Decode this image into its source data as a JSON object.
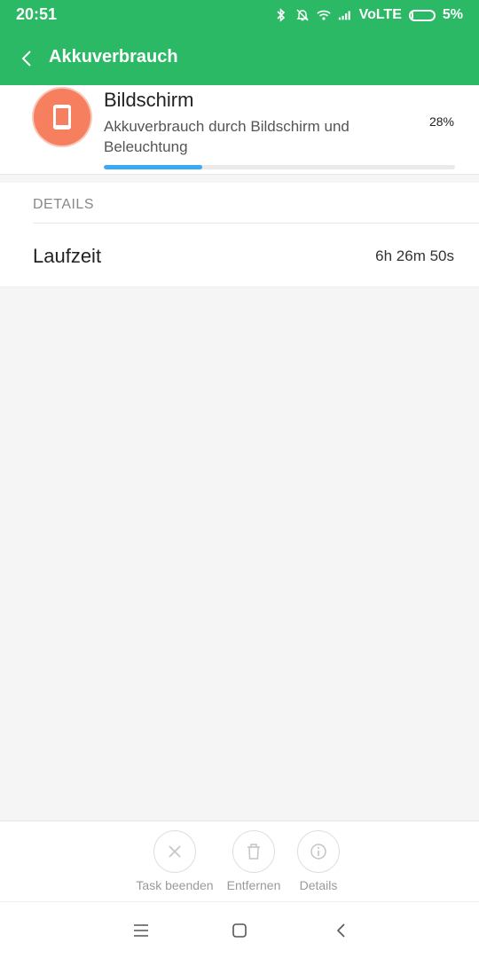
{
  "status": {
    "time": "20:51",
    "network": "VoLTE",
    "battery": "5%",
    "icons": [
      "bluetooth-icon",
      "notifications-off-icon",
      "wifi-icon",
      "signal-icon",
      "battery-icon"
    ]
  },
  "toolbar": {
    "title": "Akkuverbrauch",
    "back_icon": "chevron-left-icon"
  },
  "app": {
    "name": "Bildschirm",
    "description": "Akkuverbrauch durch Bildschirm und Beleuchtung",
    "percent": "28%",
    "usage_fraction": 0.28,
    "icon": "tablet-icon",
    "icon_color": "#f57f5f"
  },
  "details": {
    "header": "DETAILS",
    "runtime_label": "Laufzeit",
    "runtime_value": "6h 26m 50s"
  },
  "actions": {
    "end_task": "Task beenden",
    "remove": "Entfernen",
    "details": "Details"
  },
  "colors": {
    "header": "#2bb965",
    "progress": "#39aaf0"
  }
}
